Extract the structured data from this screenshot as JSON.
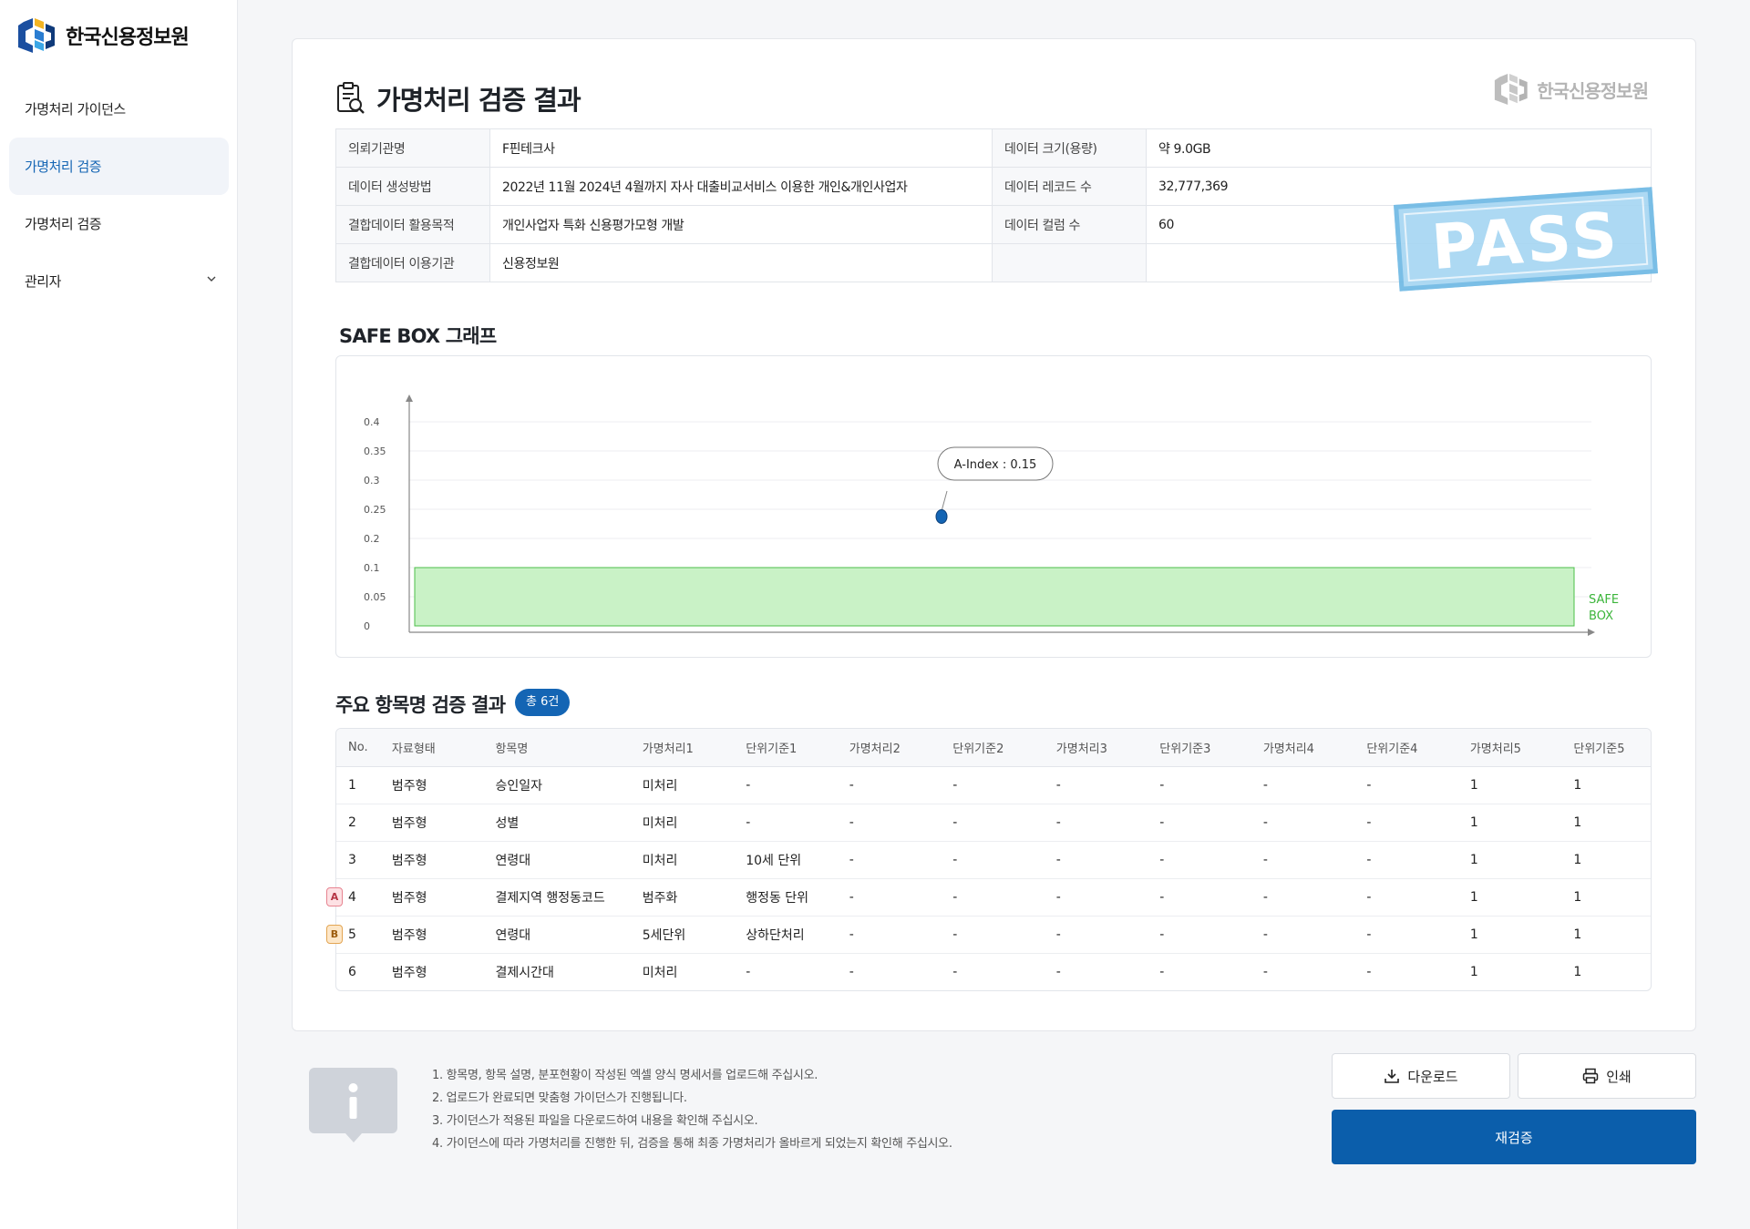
{
  "brand": {
    "name": "한국신용정보원"
  },
  "sidebar": {
    "items": [
      {
        "label": "가명처리 가이던스"
      },
      {
        "label": "가명처리 검증"
      },
      {
        "label": "가명처리 검증"
      },
      {
        "label": "관리자"
      }
    ]
  },
  "page": {
    "title": "가명처리 검증 결과",
    "watermark": "한국신용정보원",
    "stamp": "PASS"
  },
  "info": {
    "rows": [
      {
        "k1": "의뢰기관명",
        "v1": "F핀테크사",
        "k2": "데이터 크기(용량)",
        "v2": "약 9.0GB"
      },
      {
        "k1": "데이터 생성방법",
        "v1": "2022년 11월 2024년 4월까지 자사 대출비교서비스 이용한 개인&개인사업자",
        "k2": "데이터 레코드 수",
        "v2": "32,777,369"
      },
      {
        "k1": "결합데이터 활용목적",
        "v1": "개인사업자 특화 신용평가모형 개발",
        "k2": "데이터 컬럼 수",
        "v2": "60"
      },
      {
        "k1": "결합데이터 이용기관",
        "v1": "신용정보원",
        "k2": "",
        "v2": ""
      }
    ]
  },
  "chart_section": {
    "title": "SAFE BOX 그래프"
  },
  "chart_data": {
    "type": "scatter",
    "y_ticks": [
      "0.4",
      "0.35",
      "0.3",
      "0.25",
      "0.2",
      "0.1",
      "0.05",
      "0"
    ],
    "point": {
      "label": "A-Index",
      "value": 0.15,
      "tooltip": "A-Index : 0.15"
    },
    "safe_box": {
      "label_line1": "SAFE",
      "label_line2": "BOX",
      "color": "#c9f2c6",
      "border": "#4cbf4a"
    },
    "point_color": "#1465b4"
  },
  "table_section": {
    "title": "주요 항목명 검증 결과",
    "badge": "총 6건"
  },
  "table": {
    "headers": [
      "No.",
      "자료형태",
      "항목명",
      "가명처리1",
      "단위기준1",
      "가명처리2",
      "단위기준2",
      "가명처리3",
      "단위기준3",
      "가명처리4",
      "단위기준4",
      "가명처리5",
      "단위기준5"
    ],
    "rows": [
      [
        "1",
        "범주형",
        "승인일자",
        "미처리",
        "-",
        "-",
        "-",
        "-",
        "-",
        "-",
        "-",
        "1",
        "1"
      ],
      [
        "2",
        "범주형",
        "성별",
        "미처리",
        "-",
        "-",
        "-",
        "-",
        "-",
        "-",
        "-",
        "1",
        "1"
      ],
      [
        "3",
        "범주형",
        "연령대",
        "미처리",
        "10세 단위",
        "-",
        "-",
        "-",
        "-",
        "-",
        "-",
        "1",
        "1"
      ],
      [
        "4",
        "범주형",
        "결제지역 행정동코드",
        "범주화",
        "행정동 단위",
        "-",
        "-",
        "-",
        "-",
        "-",
        "-",
        "1",
        "1"
      ],
      [
        "5",
        "범주형",
        "연령대",
        "5세단위",
        "상하단처리",
        "-",
        "-",
        "-",
        "-",
        "-",
        "-",
        "1",
        "1"
      ],
      [
        "6",
        "범주형",
        "결제시간대",
        "미처리",
        "-",
        "-",
        "-",
        "-",
        "-",
        "-",
        "-",
        "1",
        "1"
      ]
    ],
    "markers": {
      "row4": "A",
      "row5": "B"
    }
  },
  "notes": [
    "1. 항목명, 항목 설명, 분포현황이 작성된 엑셀 양식 명세서를 업로드해 주십시오.",
    "2. 업로드가 완료되면 맞춤형 가이던스가 진행됩니다.",
    "3. 가이던스가 적용된 파일을 다운로드하여 내용을 확인해 주십시오.",
    "4. 가이던스에 따라 가명처리를 진행한 뒤, 검증을 통해 최종 가명처리가 올바르게 되었는지 확인해 주십시오."
  ],
  "actions": {
    "download": "다운로드",
    "print": "인쇄",
    "recheck": "재검증"
  }
}
